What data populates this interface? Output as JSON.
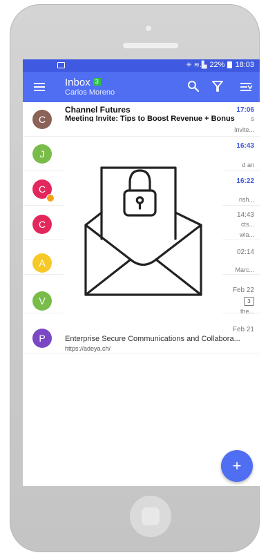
{
  "status_bar": {
    "signal": "✳ ≋.▙",
    "battery_percent": "22%",
    "time": "18:03"
  },
  "toolbar": {
    "title": "Inbox",
    "unread_count": "3",
    "account_name": "Carlos Moreno",
    "icons": [
      "menu-icon",
      "search-icon",
      "filter-icon",
      "sort-icon"
    ]
  },
  "emails": [
    {
      "avatar_letter": "C",
      "avatar_color": "#8a6257",
      "sender": "Channel Futures",
      "subject": "Meeting Invite: Tips to Boost Revenue + Bonus",
      "time": "17:06",
      "fragment_1": "s",
      "fragment_2": "Invite...",
      "unread": true
    },
    {
      "avatar_letter": "J",
      "avatar_color": "#79bc4a",
      "time": "16:43",
      "fragment_1": "d an",
      "unread": true
    },
    {
      "avatar_letter": "C",
      "avatar_color": "#e3275d",
      "time": "16:22",
      "fragment_1": "nsh...",
      "unread": true,
      "lock_badge": true
    },
    {
      "avatar_letter": "C",
      "avatar_color": "#e3275d",
      "time": "14:43",
      "fragment_1": "cts...",
      "fragment_2": "wia...",
      "unread": false
    },
    {
      "avatar_letter": "A",
      "avatar_color": "#f7c928",
      "time": "02:14",
      "fragment_1": "Marc...",
      "unread": false
    },
    {
      "avatar_letter": "V",
      "avatar_color": "#79bc4a",
      "time": "Feb 22",
      "thread_count": "3",
      "fragment_1": "the...",
      "unread": false
    },
    {
      "avatar_letter": "P",
      "avatar_color": "#7b47c4",
      "time": "Feb 21",
      "subject": "Enterprise Secure Communications and Collabora...",
      "snippet": "https://adeya.ch/",
      "unread": false
    }
  ],
  "overlay": {
    "icon": "locked-envelope-icon"
  },
  "fab": {
    "label": "+"
  }
}
